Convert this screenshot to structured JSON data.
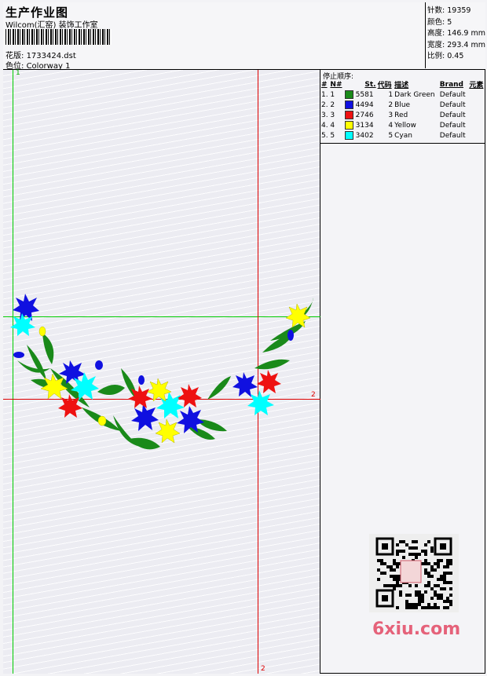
{
  "header": {
    "title": "生产作业图",
    "studio": "Wilcom(汇窑) 装饰工作室",
    "pattern_label": "花版:",
    "pattern_value": "1733424.dst",
    "colorway_label": "色位:",
    "colorway_value": "Colorway 1"
  },
  "stats": [
    {
      "label": "针数:",
      "value": "19359"
    },
    {
      "label": "颜色:",
      "value": "5"
    },
    {
      "label": "高度:",
      "value": "146.9 mm"
    },
    {
      "label": "宽度:",
      "value": "293.4 mm"
    },
    {
      "label": "比例:",
      "value": "0.45"
    }
  ],
  "markers": {
    "green_v": "1",
    "red_h": "2",
    "red_v": "2"
  },
  "stop_sequence": {
    "title": "停止顺序:",
    "columns": [
      "#",
      "N#",
      "St.",
      "代码",
      "描述",
      "Brand",
      "元素"
    ],
    "rows": [
      {
        "num": "1.",
        "n": "1",
        "color": "#1a8a1a",
        "st": "5581",
        "code": "1",
        "desc": "Dark Green",
        "brand": "Default"
      },
      {
        "num": "2.",
        "n": "2",
        "color": "#1010e0",
        "st": "4494",
        "code": "2",
        "desc": "Blue",
        "brand": "Default"
      },
      {
        "num": "3.",
        "n": "3",
        "color": "#ee1111",
        "st": "2746",
        "code": "3",
        "desc": "Red",
        "brand": "Default"
      },
      {
        "num": "4.",
        "n": "4",
        "color": "#ffff00",
        "st": "3134",
        "code": "4",
        "desc": "Yellow",
        "brand": "Default"
      },
      {
        "num": "5.",
        "n": "5",
        "color": "#00ffff",
        "st": "3402",
        "code": "5",
        "desc": "Cyan",
        "brand": "Default"
      }
    ]
  },
  "watermark": {
    "site": "6xiu.com"
  },
  "colors": {
    "dark_green": "#1a8a1a",
    "blue": "#1010e0",
    "red": "#ee1111",
    "yellow": "#ffff00",
    "cyan": "#00ffff",
    "guide_green": "#00cc00",
    "guide_red": "#dd0000"
  }
}
